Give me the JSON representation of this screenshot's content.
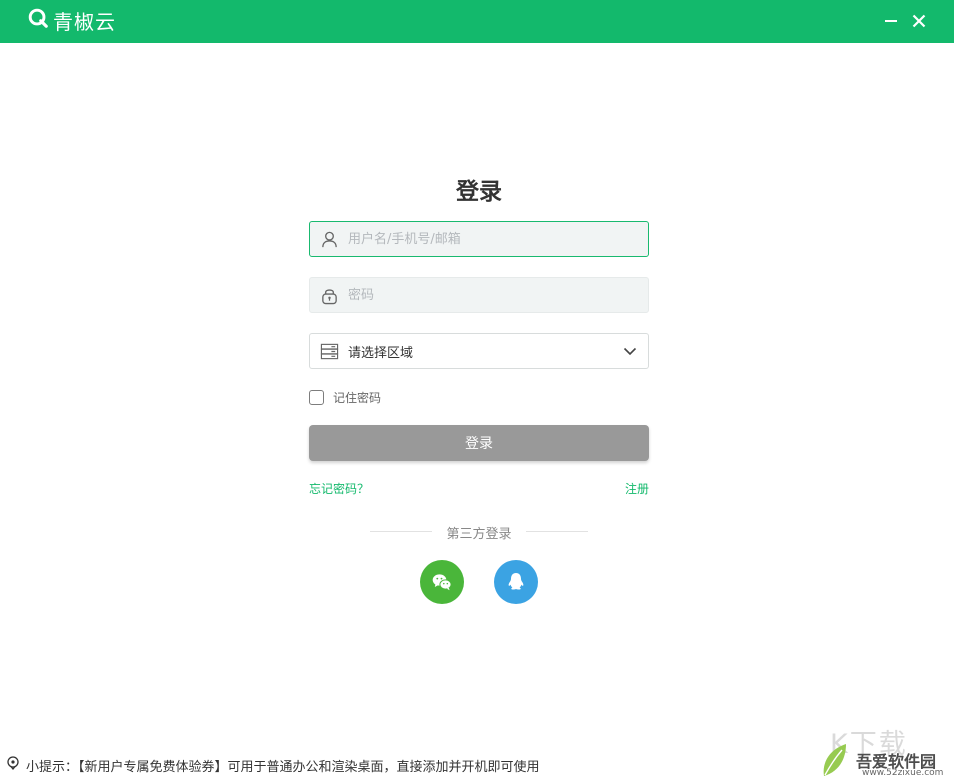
{
  "app": {
    "name": "青椒云",
    "brand_color": "#13b96c",
    "window_controls": [
      "minimize-icon",
      "close-icon"
    ]
  },
  "login": {
    "title": "登录",
    "username_placeholder": "用户名/手机号/邮箱",
    "password_placeholder": "密码",
    "region_label": "请选择区域",
    "remember_label": "记住密码",
    "remember_checked": false,
    "submit_label": "登录",
    "forgot_label": "忘记密码？",
    "register_label": "注册",
    "third_party_label": "第三方登录",
    "third_party": [
      {
        "name": "wechat",
        "icon": "wechat-icon",
        "color": "#4ab63a"
      },
      {
        "name": "qq",
        "icon": "qq-icon",
        "color": "#3ba3e3"
      }
    ]
  },
  "footer": {
    "tip": "小提示：【新用户专属免费体验券】可用于普通办公和渲染桌面，直接添加并开机即可使用"
  },
  "watermark": {
    "text": "K下载",
    "site_name": "吾爱软件园",
    "url": "www.52zixue.com"
  }
}
